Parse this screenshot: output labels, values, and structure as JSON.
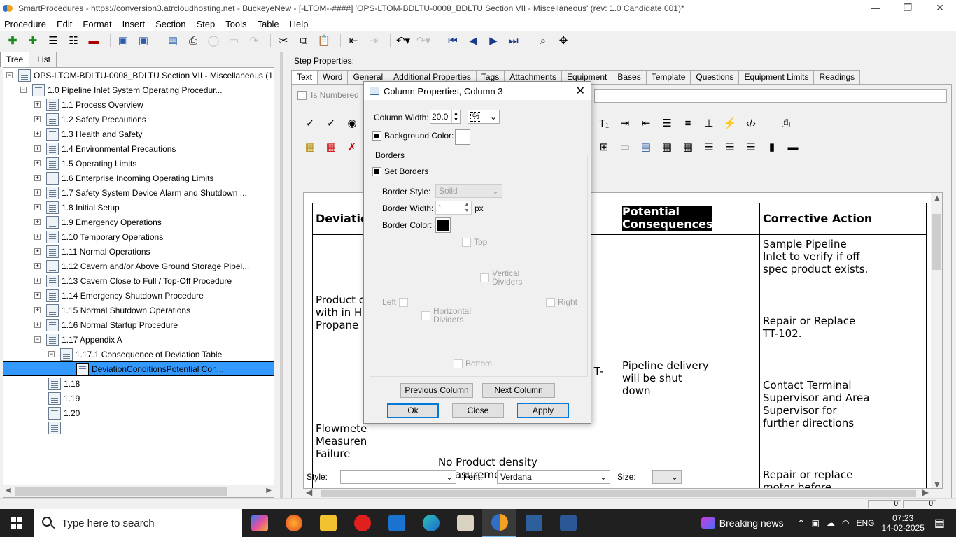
{
  "window": {
    "title": "SmartProcedures - https://conversion3.atrcloudhosting.net - BuckeyeNew - [-LTOM--####] 'OPS-LTOM-BDLTU-0008_BDLTU Section VII - Miscellaneous' (rev: 1.0 Candidate 001)*",
    "minimize": "—",
    "restore": "❐",
    "close": "✕"
  },
  "menu": [
    "Procedure",
    "Edit",
    "Format",
    "Insert",
    "Section",
    "Step",
    "Tools",
    "Table",
    "Help"
  ],
  "left_tabs": [
    "Tree",
    "List"
  ],
  "tree": {
    "root": "OPS-LTOM-BDLTU-0008_BDLTU Section VII - Miscellaneous (1.0...",
    "section": "1.0 Pipeline Inlet System Operating Procedur...",
    "items": [
      "1.1 Process Overview",
      "1.2 Safety Precautions",
      "1.3 Health and Safety",
      "1.4 Environmental Precautions",
      "1.5 Operating Limits",
      "1.6 Enterprise Incoming Operating Limits",
      "1.7 Safety System Device Alarm and Shutdown ...",
      "1.8 Initial Setup",
      "1.9 Emergency Operations",
      "1.10 Temporary Operations",
      "1.11 Normal Operations",
      "1.12 Cavern and/or Above Ground Storage Pipel...",
      "1.13 Cavern Close to Full / Top-Off Procedure",
      "1.14 Emergency Shutdown Procedure",
      "1.15 Normal Shutdown Operations",
      "1.16 Normal Startup Procedure"
    ],
    "appendix": "1.17 Appendix A",
    "subsection": "1.17.1 Consequence of Deviation Table",
    "selected": "DeviationConditionsPotential Con...",
    "after": [
      "1.18",
      "1.19",
      "1.20"
    ]
  },
  "step_properties_label": "Step Properties:",
  "tabs": [
    "Text",
    "Word",
    "General",
    "Additional Properties",
    "Tags",
    "Attachments",
    "Equipment",
    "Bases",
    "Template",
    "Questions",
    "Equipment Limits",
    "Readings"
  ],
  "is_numbered": "Is Numbered",
  "table": {
    "headers": [
      "Deviatio",
      "",
      "Potential Consequences",
      "Corrective Action"
    ],
    "col1": [
      "Product c\nwith in H\nPropane",
      "Flowmete\nMeasuren\nFailure"
    ],
    "col2": [
      "T-",
      "No Product density\nmeasurement"
    ],
    "col3": [
      "Pipeline delivery\nwill be shut\ndown"
    ],
    "col4": [
      "Sample Pipeline\nInlet to verify if off\nspec product exists.",
      "Repair or Replace\nTT-102.",
      "Contact Terminal\nSupervisor and Area\nSupervisor for\nfurther directions",
      "Repair or replace\nmotor before"
    ]
  },
  "style_bar": {
    "style_label": "Style:",
    "style_value": "",
    "font_label": "Font:",
    "font_value": "Verdana",
    "size_label": "Size:",
    "size_value": ""
  },
  "status": [
    "0",
    "0"
  ],
  "dialog": {
    "title": "Column Properties, Column 3",
    "column_width_label": "Column Width:",
    "column_width_value": "20.0",
    "unit_value": "%",
    "background_color_label": "Background Color:",
    "borders_group": "Borders",
    "set_borders": "Set Borders",
    "border_style_label": "Border Style:",
    "border_style_value": "Solid",
    "border_width_label": "Border Width:",
    "border_width_value": "1",
    "border_width_unit": "px",
    "border_color_label": "Border Color:",
    "top": "Top",
    "vertical_dividers": "Vertical\nDividers",
    "left": "Left",
    "right": "Right",
    "horizontal_dividers": "Horizontal\nDividers",
    "bottom": "Bottom",
    "previous_column": "Previous Column",
    "next_column": "Next Column",
    "ok": "Ok",
    "close": "Close",
    "apply": "Apply"
  },
  "taskbar": {
    "search_placeholder": "Type here to search",
    "news": "Breaking news",
    "lang": "ENG",
    "time": "07:23",
    "date": "14-02-2025"
  },
  "colors": {
    "selection": "#3399ff",
    "dialog_default_border": "#0078d7",
    "taskbar": "#202020"
  }
}
